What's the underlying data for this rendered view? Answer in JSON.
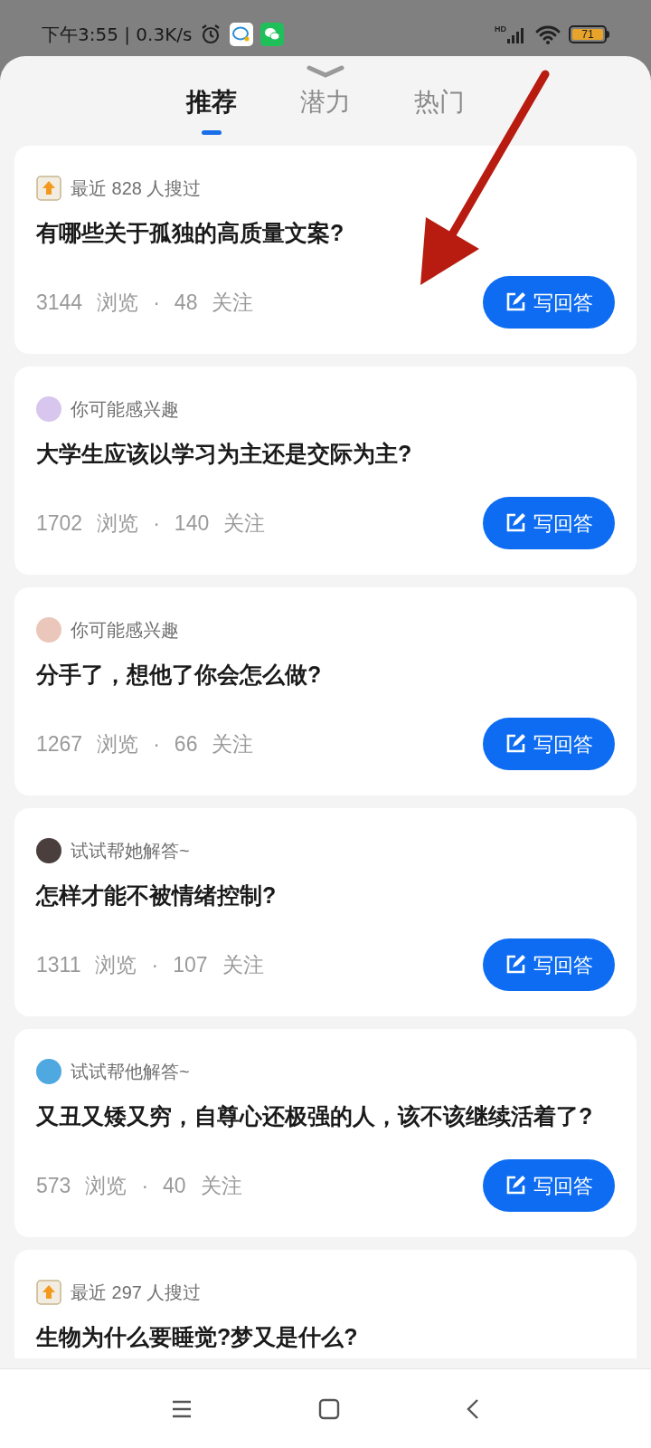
{
  "status_bar": {
    "time": "下午3:55 | 0.3K/s",
    "network_label": "HD",
    "battery": "71"
  },
  "tabs": [
    {
      "label": "推荐",
      "selected": true
    },
    {
      "label": "潜力",
      "selected": false
    },
    {
      "label": "热门",
      "selected": false
    }
  ],
  "questions": [
    {
      "kind": "trending",
      "reason": "最近 828 人搜过",
      "title": "有哪些关于孤独的高质量文案?",
      "views": "3144",
      "views_label": "浏览",
      "separator": "·",
      "follows": "48",
      "follows_label": "关注",
      "button": "写回答"
    },
    {
      "kind": "avatar",
      "color": "#d9c6ee",
      "reason": "你可能感兴趣",
      "title": "大学生应该以学习为主还是交际为主?",
      "views": "1702",
      "views_label": "浏览",
      "separator": "·",
      "follows": "140",
      "follows_label": "关注",
      "button": "写回答"
    },
    {
      "kind": "avatar",
      "color": "#ebc7bb",
      "reason": "你可能感兴趣",
      "title": "分手了，想他了你会怎么做?",
      "views": "1267",
      "views_label": "浏览",
      "separator": "·",
      "follows": "66",
      "follows_label": "关注",
      "button": "写回答"
    },
    {
      "kind": "avatar",
      "color": "#4a3f3c",
      "reason": "试试帮她解答~",
      "title": "怎样才能不被情绪控制?",
      "views": "1311",
      "views_label": "浏览",
      "separator": "·",
      "follows": "107",
      "follows_label": "关注",
      "button": "写回答"
    },
    {
      "kind": "avatar",
      "color": "#4fa8e0",
      "reason": "试试帮他解答~",
      "title": "又丑又矮又穷，自尊心还极强的人，该不该继续活着了?",
      "views": "573",
      "views_label": "浏览",
      "separator": "·",
      "follows": "40",
      "follows_label": "关注",
      "button": "写回答"
    },
    {
      "kind": "trending",
      "reason": "最近 297 人搜过",
      "title": "生物为什么要睡觉?梦又是什么?"
    }
  ]
}
